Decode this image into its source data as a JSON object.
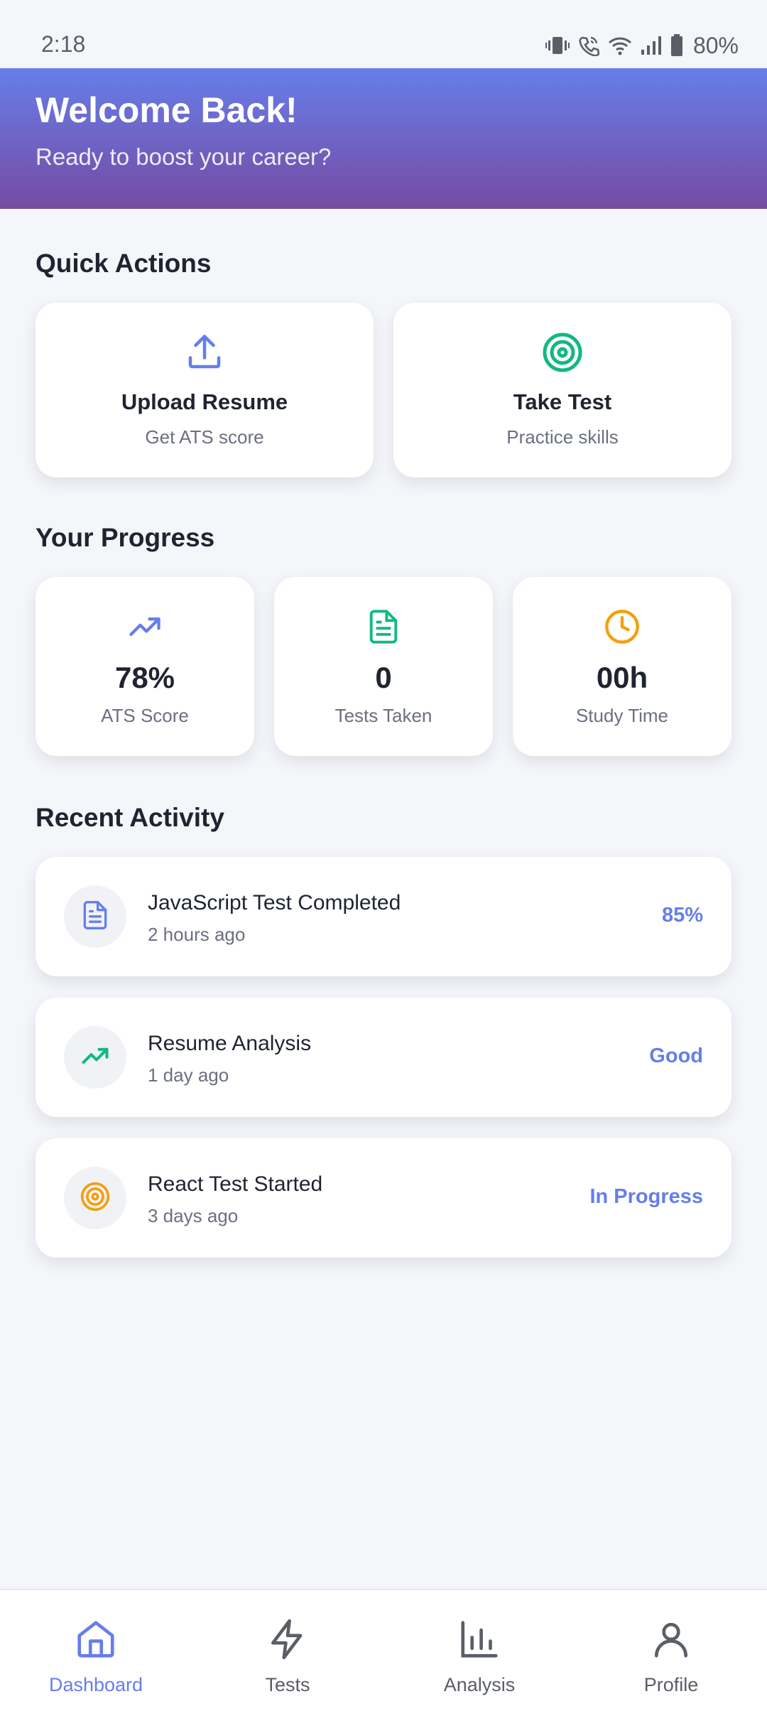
{
  "status_bar": {
    "time": "2:18",
    "battery": "80%",
    "icons": [
      "vibrate-icon",
      "wifi-call-icon",
      "wifi-icon",
      "signal-icon",
      "battery-icon"
    ]
  },
  "header": {
    "title": "Welcome Back!",
    "subtitle": "Ready to boost your career?",
    "gradient": [
      "#667eea",
      "#764ba2"
    ]
  },
  "quick_actions": {
    "title": "Quick Actions",
    "items": [
      {
        "title": "Upload Resume",
        "subtitle": "Get ATS score",
        "icon": "upload-icon",
        "color": "#667eea"
      },
      {
        "title": "Take Test",
        "subtitle": "Practice skills",
        "icon": "target-icon",
        "color": "#10b981"
      }
    ]
  },
  "progress": {
    "title": "Your Progress",
    "items": [
      {
        "value": "78%",
        "label": "ATS Score",
        "icon": "trending-up-icon",
        "color": "#667eea"
      },
      {
        "value": "0",
        "label": "Tests Taken",
        "icon": "document-icon",
        "color": "#10b981"
      },
      {
        "value": "00h",
        "label": "Study Time",
        "icon": "clock-icon",
        "color": "#f59e0b"
      }
    ]
  },
  "recent_activity": {
    "title": "Recent Activity",
    "items": [
      {
        "title": "JavaScript Test Completed",
        "time": "2 hours ago",
        "badge": "85%",
        "icon": "document-icon",
        "color": "#667eea"
      },
      {
        "title": "Resume Analysis",
        "time": "1 day ago",
        "badge": "Good",
        "icon": "trending-up-icon",
        "color": "#10b981"
      },
      {
        "title": "React Test Started",
        "time": "3 days ago",
        "badge": "In Progress",
        "icon": "target-icon",
        "color": "#f59e0b"
      }
    ]
  },
  "bottom_nav": {
    "items": [
      {
        "label": "Dashboard",
        "icon": "home-icon",
        "active": true
      },
      {
        "label": "Tests",
        "icon": "lightning-icon",
        "active": false
      },
      {
        "label": "Analysis",
        "icon": "bar-chart-icon",
        "active": false
      },
      {
        "label": "Profile",
        "icon": "user-icon",
        "active": false
      }
    ],
    "active_color": "#667eea",
    "inactive_color": "#5a5e66"
  }
}
